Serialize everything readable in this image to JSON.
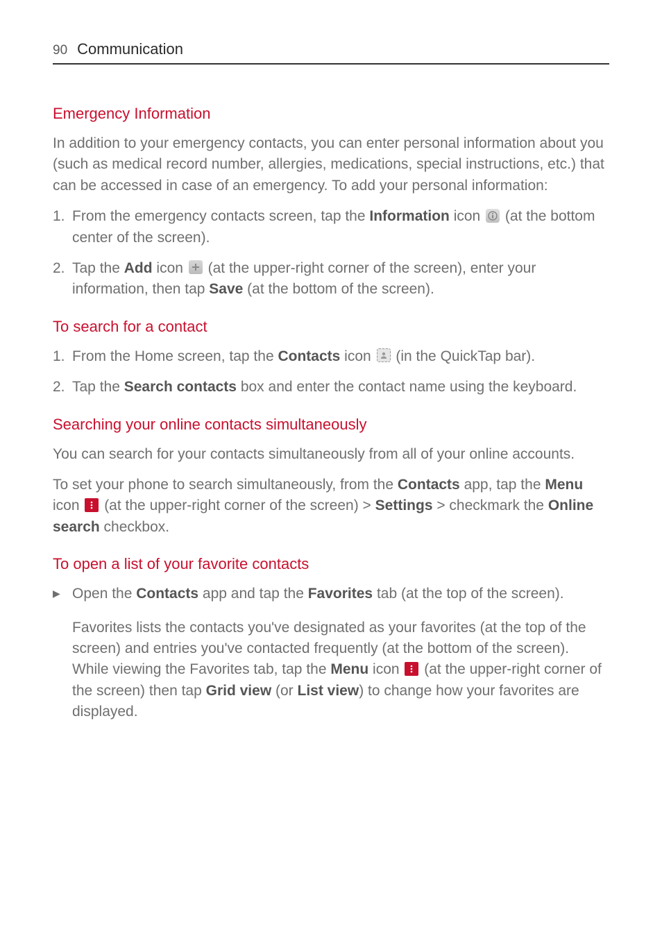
{
  "header": {
    "page_number": "90",
    "section": "Communication"
  },
  "s1": {
    "title": "Emergency Information",
    "intro": "In addition to your emergency contacts, you can enter personal information about you (such as medical record number, allergies, medications, special instructions, etc.) that can be accessed in case of an emergency.  To add your personal information:",
    "item1_num": "1.",
    "item1_a": "From the emergency contacts screen, tap the ",
    "item1_bold1": "Information",
    "item1_b": " icon ",
    "item1_c": " (at the bottom center of the screen).",
    "item2_num": "2.",
    "item2_a": "Tap the ",
    "item2_bold1": "Add",
    "item2_b": " icon ",
    "item2_c": " (at the upper-right corner of the screen), enter your information, then tap ",
    "item2_bold2": "Save",
    "item2_d": " (at the bottom of the screen)."
  },
  "s2": {
    "title": "To search for a contact",
    "item1_num": "1.",
    "item1_a": "From the Home screen, tap the ",
    "item1_bold1": "Contacts",
    "item1_b": " icon ",
    "item1_c": " (in the QuickTap bar).",
    "item2_num": "2.",
    "item2_a": "Tap the ",
    "item2_bold1": "Search contacts",
    "item2_b": " box and enter the contact name using the keyboard."
  },
  "s3": {
    "title": "Searching your online contacts simultaneously",
    "p1": "You can search for your contacts simultaneously from all of your online accounts.",
    "p2_a": "To set your phone to search simultaneously, from the ",
    "p2_bold1": "Contacts",
    "p2_b": " app, tap the ",
    "p2_bold2": "Menu",
    "p2_c": " icon ",
    "p2_d": " (at the upper-right corner of the screen) > ",
    "p2_bold3": "Settings",
    "p2_e": " > checkmark the ",
    "p2_bold4": "Online search",
    "p2_f": " checkbox."
  },
  "s4": {
    "title": "To open a list of your favorite contacts",
    "b1_mark": "▶",
    "b1_a": "Open the ",
    "b1_bold1": "Contacts",
    "b1_b": " app and tap the ",
    "b1_bold2": "Favorites",
    "b1_c": " tab (at the top of the screen).",
    "p1_a": "Favorites lists the contacts you've designated as your favorites (at the top of the screen) and entries you've contacted frequently (at the bottom of the screen). While viewing the Favorites tab, tap the ",
    "p1_bold1": "Menu",
    "p1_b": " icon ",
    "p1_c": " (at the upper-right corner of the screen) then tap ",
    "p1_bold2": "Grid view",
    "p1_d": " (or ",
    "p1_bold3": "List view",
    "p1_e": ") to change how your favorites are displayed."
  }
}
